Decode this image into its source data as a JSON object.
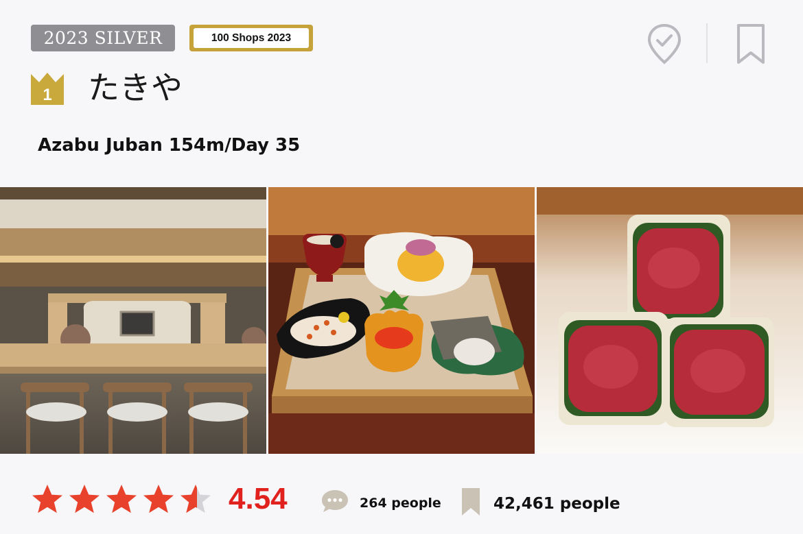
{
  "badges": {
    "silver": "2023 SILVER",
    "hundred_shops": "100 Shops 2023"
  },
  "rank": {
    "number": "1",
    "icon": "crown-icon"
  },
  "shop": {
    "name": "たきや",
    "location": "Azabu Juban 154m/Day 35"
  },
  "header_actions": {
    "checkin_icon": "checkin-pin-icon",
    "bookmark_icon": "bookmark-icon"
  },
  "photos": [
    {
      "subject": "counter-interior"
    },
    {
      "subject": "appetizer-tray"
    },
    {
      "subject": "beef-rolls"
    }
  ],
  "rating": {
    "score": "4.54",
    "stars_value": 4.54,
    "stars_max": 5,
    "star_color": "#e8412c"
  },
  "stats": {
    "reviews": "264 people",
    "saves": "42,461 people"
  },
  "colors": {
    "silver_badge": "#8e8e93",
    "gold_badge": "#c6a23a",
    "score_red": "#e0211d",
    "muted_icon": "#b9b9bf"
  }
}
